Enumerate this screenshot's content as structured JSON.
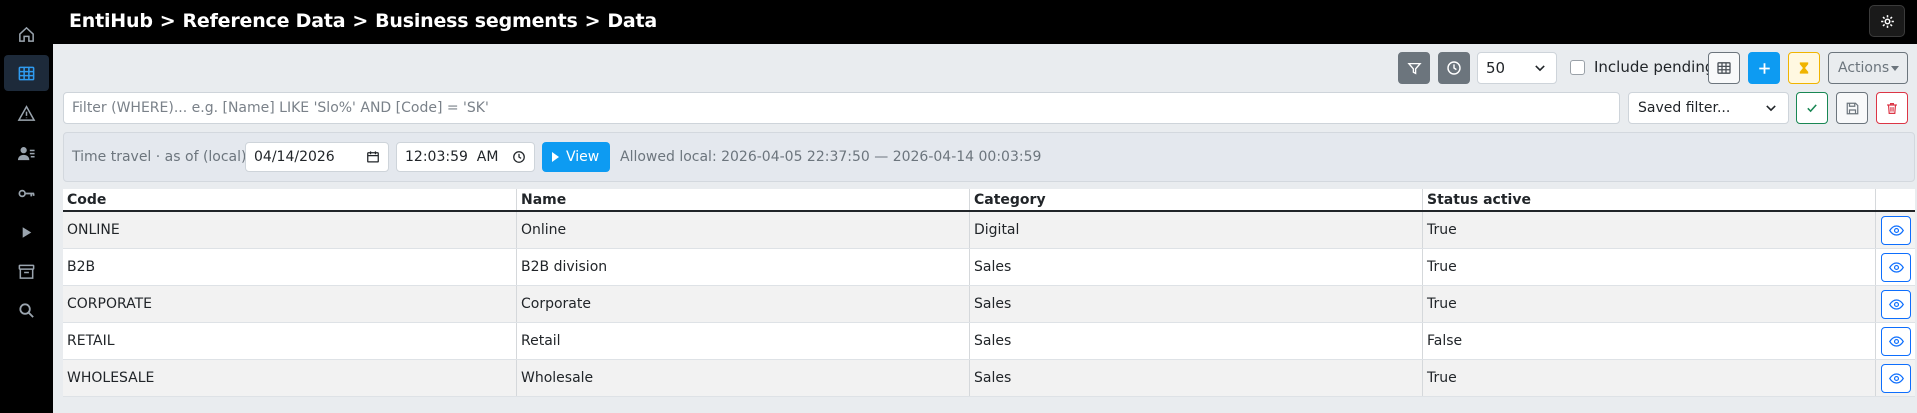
{
  "header": {
    "breadcrumb": [
      "EntiHub",
      "Reference Data",
      "Business segments",
      "Data"
    ],
    "separator": ">"
  },
  "sidebar": {
    "items": [
      {
        "icon": "home-icon",
        "active": false
      },
      {
        "icon": "table-icon",
        "active": true
      },
      {
        "icon": "warning-icon",
        "active": false
      },
      {
        "icon": "users-icon",
        "active": false
      },
      {
        "icon": "key-icon",
        "active": false
      },
      {
        "icon": "play-icon",
        "active": false
      },
      {
        "icon": "archive-icon",
        "active": false
      },
      {
        "icon": "search-icon",
        "active": false
      }
    ]
  },
  "toolbar": {
    "page_size": "50",
    "include_pending_label": "Include pending",
    "include_pending_checked": false,
    "actions_label": "Actions"
  },
  "filter": {
    "placeholder": "Filter (WHERE)... e.g. [Name] LIKE 'Slo%' AND [Code] = 'SK'",
    "saved_filter_label": "Saved filter..."
  },
  "time_travel": {
    "label": "Time travel · as of (local)",
    "date": "04/14/2026",
    "time": "12:03:59  AM",
    "view_label": "View",
    "allowed": "Allowed local: 2026-04-05 22:37:50 — 2026-04-14 00:03:59"
  },
  "table": {
    "columns": [
      "Code",
      "Name",
      "Category",
      "Status active"
    ],
    "rows": [
      [
        "ONLINE",
        "Online",
        "Digital",
        "True"
      ],
      [
        "B2B",
        "B2B division",
        "Sales",
        "True"
      ],
      [
        "CORPORATE",
        "Corporate",
        "Sales",
        "True"
      ],
      [
        "RETAIL",
        "Retail",
        "Sales",
        "False"
      ],
      [
        "WHOLESALE",
        "Wholesale",
        "Sales",
        "True"
      ]
    ]
  },
  "colors": {
    "accent": "#0d9bf2",
    "header_bg": "#000000",
    "success": "#198754",
    "danger": "#dc3545",
    "warning": "#f0b400"
  }
}
